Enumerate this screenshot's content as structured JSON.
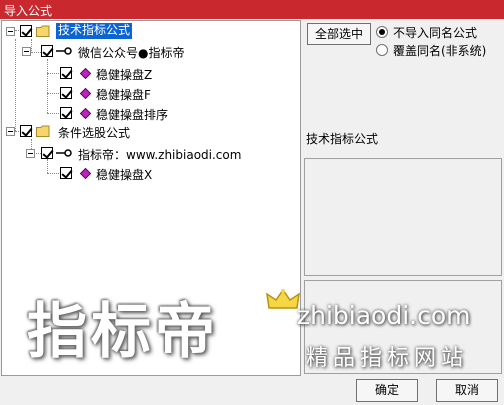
{
  "window": {
    "title": "导入公式"
  },
  "tree": {
    "nodes": [
      {
        "label": "技术指标公式",
        "level": 0,
        "type": "folder",
        "selected": true
      },
      {
        "label": "微信公众号●指标帝",
        "level": 1,
        "type": "key"
      },
      {
        "label": "稳健操盘Z",
        "level": 2,
        "type": "formula"
      },
      {
        "label": "稳健操盘F",
        "level": 2,
        "type": "formula"
      },
      {
        "label": "稳健操盘排序",
        "level": 2,
        "type": "formula"
      },
      {
        "label": "条件选股公式",
        "level": 0,
        "type": "folder"
      },
      {
        "label": "指标帝：www.zhibiaodi.com",
        "level": 1,
        "type": "key"
      },
      {
        "label": "稳健操盘X",
        "level": 2,
        "type": "formula"
      }
    ]
  },
  "options": {
    "select_all_label": "全部选中",
    "radio_no_import_label": "不导入同名公式",
    "radio_overwrite_label": "覆盖同名(非系统)",
    "selected_mode": "不导入同名公式"
  },
  "info": {
    "category_label": "技术指标公式"
  },
  "footer": {
    "ok_label": "确定",
    "cancel_label": "取消"
  },
  "watermark": {
    "brand": "指标帝",
    "url": "zhibiaodi.com",
    "tagline": "精品指标网站"
  },
  "colors": {
    "titlebar": "#c8282e",
    "selection": "#0a64d6",
    "formula_icon": "#c020c0"
  }
}
